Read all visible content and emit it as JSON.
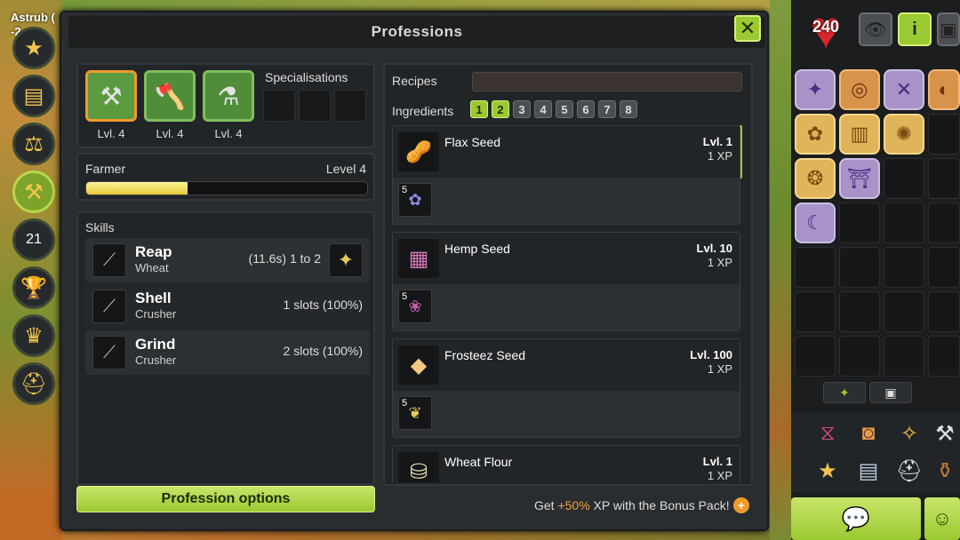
{
  "world": {
    "location": "Astrub (",
    "coords": "-2"
  },
  "window": {
    "title": "Professions",
    "close_icon": "✕"
  },
  "professions": [
    {
      "icon": "scythe-icon",
      "glyph": "⚒",
      "level": "Lvl. 4",
      "selected": true
    },
    {
      "icon": "axe-icon",
      "glyph": "🪓",
      "level": "Lvl. 4",
      "selected": false
    },
    {
      "icon": "potion-icon",
      "glyph": "⚗",
      "level": "Lvl. 4",
      "selected": false
    }
  ],
  "specialisations_label": "Specialisations",
  "farmer": {
    "label": "Farmer",
    "level_text": "Level 4",
    "progress": 0.36
  },
  "skills": {
    "label": "Skills",
    "items": [
      {
        "name": "Reap",
        "target": "Wheat",
        "info": "(11.6s) 1 to 2",
        "icon": "scythe-icon",
        "result_icon": "wheat-icon"
      },
      {
        "name": "Shell",
        "target": "Crusher",
        "info": "1 slots (100%)",
        "icon": "scythe-icon"
      },
      {
        "name": "Grind",
        "target": "Crusher",
        "info": "2 slots (100%)",
        "icon": "scythe-icon"
      }
    ]
  },
  "profession_options_label": "Profession options",
  "recipes": {
    "label": "Recipes",
    "search_value": "",
    "ingredients_label": "Ingredients",
    "ingredient_filters": [
      "1",
      "2",
      "3",
      "4",
      "5",
      "6",
      "7",
      "8"
    ],
    "active_filters": [
      0,
      1
    ],
    "list": [
      {
        "name": "Flax Seed",
        "level": "Lvl. 1",
        "xp": "1 XP",
        "icon": "flax-seed-icon",
        "glyph": "🥜",
        "ingredient_qty": "5",
        "ingredient_icon": "flax-flower-icon",
        "ingredient_glyph": "✿"
      },
      {
        "name": "Hemp Seed",
        "level": "Lvl. 10",
        "xp": "1 XP",
        "icon": "hemp-seed-icon",
        "glyph": "▦",
        "ingredient_qty": "5",
        "ingredient_icon": "hemp-plant-icon",
        "ingredient_glyph": "❀"
      },
      {
        "name": "Frosteez Seed",
        "level": "Lvl. 100",
        "xp": "1 XP",
        "icon": "frosteez-seed-icon",
        "glyph": "◆",
        "ingredient_qty": "5",
        "ingredient_icon": "frosteez-icon",
        "ingredient_glyph": "❦"
      },
      {
        "name": "Wheat Flour",
        "level": "Lvl. 1",
        "xp": "1 XP",
        "icon": "flour-sack-icon",
        "glyph": "⛁"
      }
    ]
  },
  "bonus": {
    "prefix": "Get ",
    "percent": "+50%",
    "suffix": " XP with the Bonus Pack!",
    "plus": "+"
  },
  "status": {
    "hp": "240"
  },
  "sidebar_buttons": [
    {
      "name": "eye-icon",
      "glyph": "👁"
    },
    {
      "name": "info-icon",
      "glyph": "i"
    },
    {
      "name": "camera-icon",
      "glyph": "▣"
    }
  ]
}
